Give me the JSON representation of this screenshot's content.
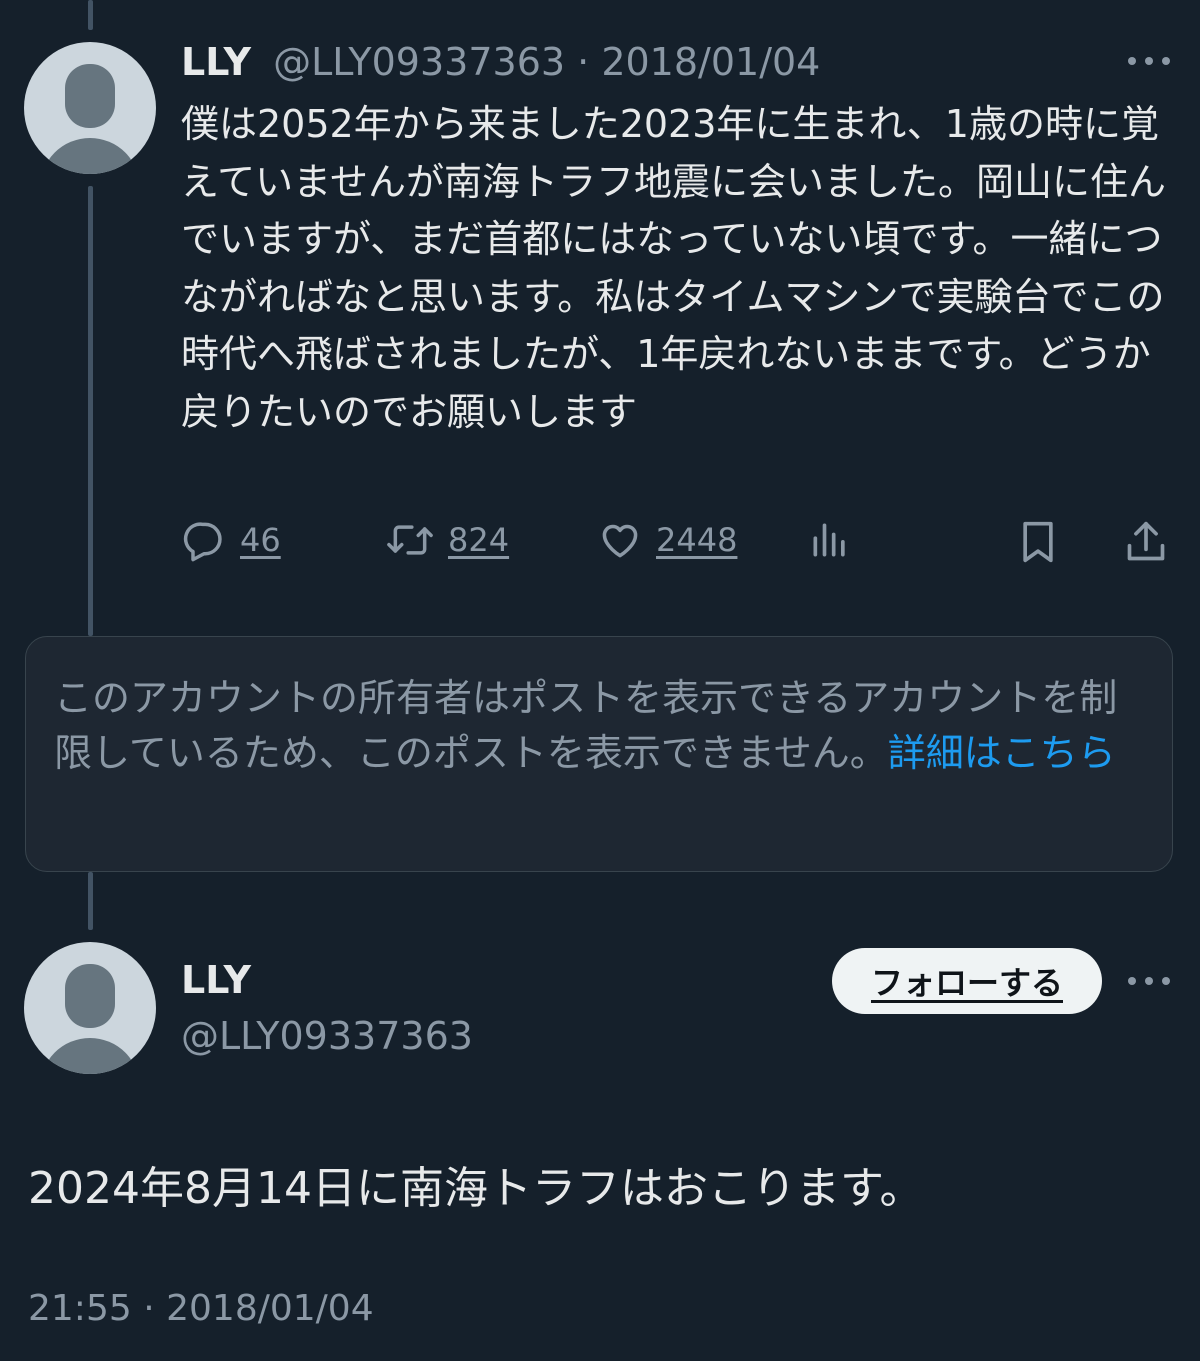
{
  "tweet1": {
    "name": "LLY",
    "handle": "@LLY09337363",
    "separator": "·",
    "date": "2018/01/04",
    "text": "僕は2052年から来ました2023年に生まれ、1歳の時に覚えていませんが南海トラフ地震に会いました。岡山に住んでいますが、まだ首都にはなっていない頃です。一緒につながればなと思います。私はタイムマシンで実験台でこの時代へ飛ばされましたが、1年戻れないままです。どうか戻りたいのでお願いします",
    "replies": "46",
    "retweets": "824",
    "likes": "2448"
  },
  "restricted": {
    "message": "このアカウントの所有者はポストを表示できるアカウントを制限しているため、このポストを表示できません。",
    "link": "詳細はこちら"
  },
  "tweet2": {
    "name": "LLY",
    "handle": "@LLY09337363",
    "follow_label": "フォローする",
    "text": "2024年8月14日に南海トラフはおこります。",
    "time": "21:55",
    "separator": "·",
    "date": "2018/01/04"
  },
  "icons": {
    "reply": "reply-icon",
    "retweet": "retweet-icon",
    "like": "heart-icon",
    "views": "views-icon",
    "bookmark": "bookmark-icon",
    "share": "share-icon",
    "more": "more-icon"
  },
  "colors": {
    "background": "#15202b",
    "text": "#e7e9ea",
    "muted": "#8b98a5",
    "link": "#1d9bf0",
    "thread_line": "#425364",
    "follow_button": "#eff3f4"
  }
}
